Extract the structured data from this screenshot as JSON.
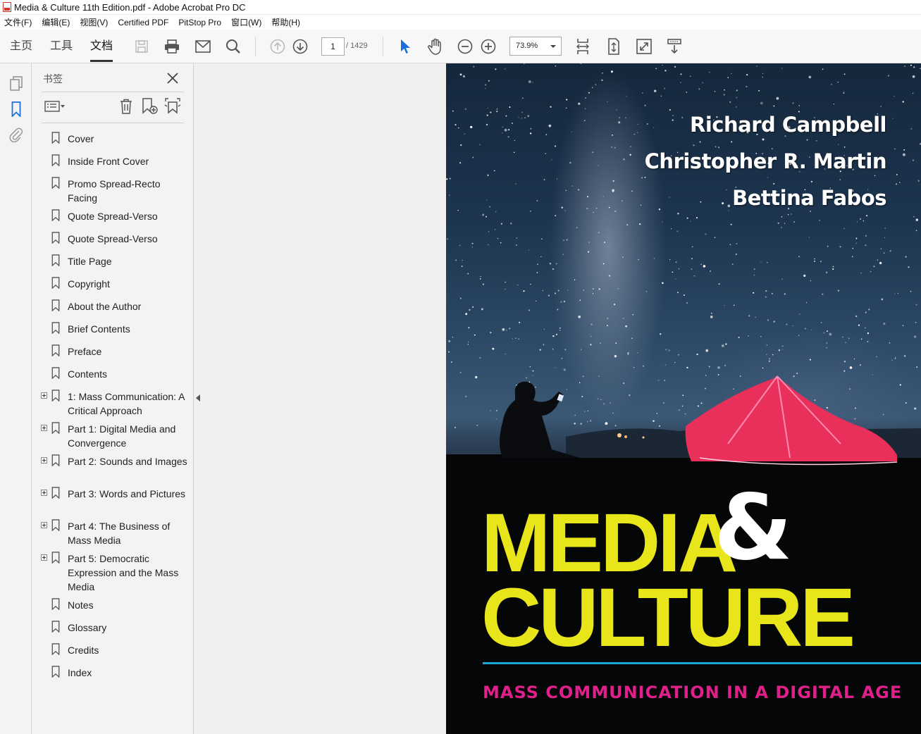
{
  "window": {
    "title": "Media & Culture 11th Edition.pdf - Adobe Acrobat Pro DC"
  },
  "menu": [
    "文件(F)",
    "编辑(E)",
    "视图(V)",
    "Certified PDF",
    "PitStop Pro",
    "窗口(W)",
    "帮助(H)"
  ],
  "toolbar": {
    "tabs": [
      "主页",
      "工具",
      "文档"
    ],
    "active_tab": "文档",
    "page_current": "1",
    "page_total": "/ 1429",
    "zoom": "73.9%"
  },
  "bookmarks": {
    "title": "书签",
    "items": [
      {
        "label": "Cover",
        "expandable": false
      },
      {
        "label": "Inside Front Cover",
        "expandable": false
      },
      {
        "label": "Promo Spread-Recto Facing",
        "expandable": false
      },
      {
        "label": "Quote Spread-Verso",
        "expandable": false
      },
      {
        "label": "Quote Spread-Verso",
        "expandable": false
      },
      {
        "label": "Title Page",
        "expandable": false
      },
      {
        "label": "Copyright",
        "expandable": false
      },
      {
        "label": "About the Author",
        "expandable": false
      },
      {
        "label": "Brief Contents",
        "expandable": false
      },
      {
        "label": "Preface",
        "expandable": false
      },
      {
        "label": "Contents",
        "expandable": false
      },
      {
        "label": "1: Mass Communication: A Critical Approach",
        "expandable": true
      },
      {
        "label": "Part 1: Digital Media and Convergence",
        "expandable": true
      },
      {
        "label": "Part 2: Sounds and Images",
        "expandable": true
      },
      {
        "label": "Part 3: Words and Pictures",
        "expandable": true
      },
      {
        "label": "Part 4: The Business of Mass Media",
        "expandable": true
      },
      {
        "label": "Part 5: Democratic Expression and the Mass Media",
        "expandable": true
      },
      {
        "label": "Notes",
        "expandable": false
      },
      {
        "label": "Glossary",
        "expandable": false
      },
      {
        "label": "Credits",
        "expandable": false
      },
      {
        "label": "Index",
        "expandable": false
      }
    ]
  },
  "cover": {
    "authors": [
      "Richard Campbell",
      "Christopher R. Martin",
      "Bettina Fabos"
    ],
    "title_line1": "MEDIA",
    "ampersand": "&",
    "title_line2": "CULTURE",
    "subtitle": "MASS COMMUNICATION IN A DIGITAL AGE",
    "colors": {
      "title": "#e8e61a",
      "subtitle": "#e0208a",
      "rule": "#1ea3d8",
      "tent": "#e8305a"
    }
  }
}
